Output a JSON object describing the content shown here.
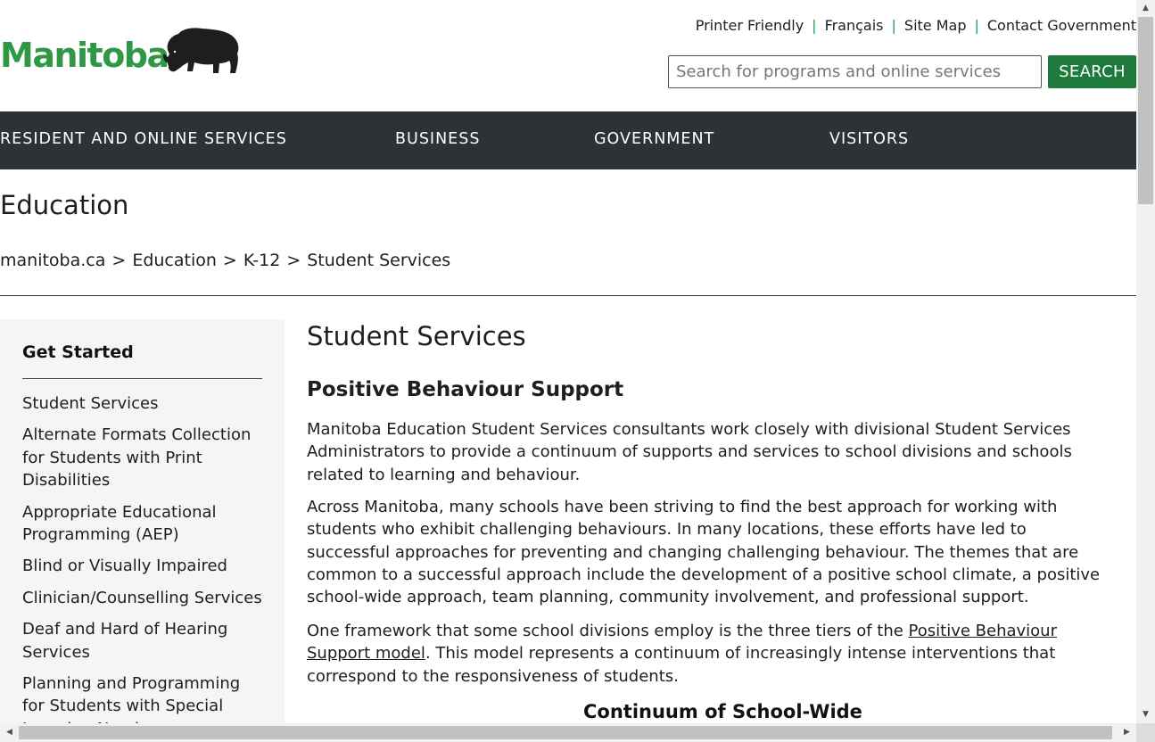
{
  "header": {
    "logo_text": "Manitoba",
    "utility_links": [
      "Printer Friendly",
      "Français",
      "Site Map",
      "Contact Government"
    ],
    "search_placeholder": "Search for programs and online services",
    "search_button": "SEARCH"
  },
  "nav": {
    "items": [
      "RESIDENT AND ONLINE SERVICES",
      "BUSINESS",
      "GOVERNMENT",
      "VISITORS"
    ]
  },
  "section_title": "Education",
  "breadcrumb": [
    "manitoba.ca",
    "Education",
    "K-12",
    "Student Services"
  ],
  "sidebar": {
    "heading": "Get Started",
    "items": [
      "Student Services",
      "Alternate Formats Collection for Students with Print Disabilities",
      "Appropriate Educational Programming (AEP)",
      "Blind or Visually Impaired",
      "Clinician/Counselling Services",
      "Deaf and Hard of Hearing Services",
      "Planning and Programming for Students with Special Learning Needs"
    ]
  },
  "main": {
    "title": "Student Services",
    "subtitle": "Positive Behaviour Support",
    "para1": "Manitoba Education Student Services consultants work closely with divisional Student Services Administrators to provide a continuum of supports and services to school divisions and schools related to learning and behaviour.",
    "para2": "Across Manitoba, many schools have been striving to find the best approach for working with students who exhibit challenging behaviours. In many locations, these efforts have led to successful approaches for preventing and changing challenging behaviour. The themes that are common to a successful approach include the development of a positive school climate, a positive school-wide approach, team planning, community involvement, and professional support.",
    "para3_before": "One framework that some school divisions employ is the three tiers of the ",
    "para3_link": "Positive Behaviour Support model",
    "para3_after": ". This model represents a continuum of increasingly intense interventions that correspond to the responsiveness of students.",
    "continuum_heading": "Continuum of School-Wide"
  },
  "colors": {
    "brand_green": "#2e9845",
    "button_green": "#1d7a3a",
    "nav_bg": "#2d3236",
    "sidebar_bg": "#f5f5f5"
  },
  "icons": {
    "logo": "bison-icon",
    "scroll_up": "arrow-up-icon",
    "scroll_down": "arrow-down-icon",
    "scroll_left": "arrow-left-icon",
    "scroll_right": "arrow-right-icon"
  }
}
